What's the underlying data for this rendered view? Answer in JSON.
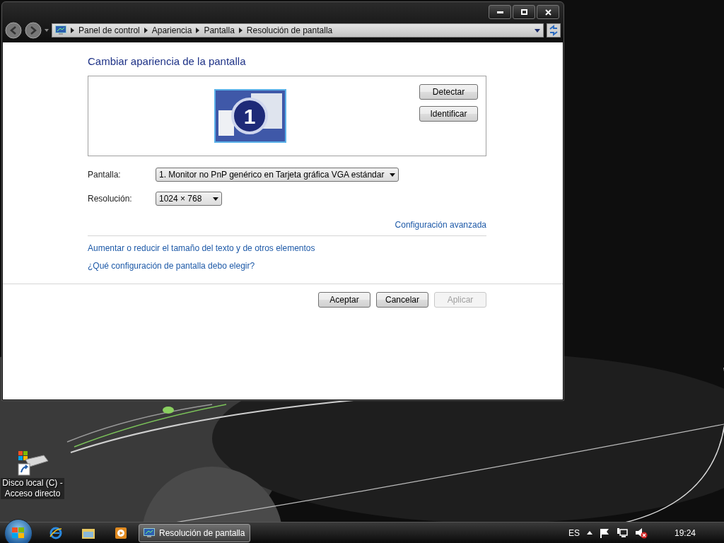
{
  "window": {
    "breadcrumb": [
      "Panel de control",
      "Apariencia",
      "Pantalla",
      "Resolución de pantalla"
    ],
    "heading": "Cambiar apariencia de la pantalla",
    "monitor_number": "1",
    "preview_buttons": [
      {
        "label": "Detectar"
      },
      {
        "label": "Identificar"
      }
    ],
    "fields": [
      {
        "label": "Pantalla:",
        "value": "1. Monitor no PnP genérico en Tarjeta gráfica VGA estándar"
      },
      {
        "label": "Resolución:",
        "value": "1024 × 768"
      }
    ],
    "advanced_link": "Configuración avanzada",
    "links": [
      "Aumentar o reducir el tamaño del texto y de otros elementos",
      "¿Qué configuración de pantalla debo elegir?"
    ],
    "dialog_buttons": [
      {
        "label": "Aceptar",
        "disabled": false
      },
      {
        "label": "Cancelar",
        "disabled": false
      },
      {
        "label": "Aplicar",
        "disabled": true
      }
    ]
  },
  "desktop_icons": [
    {
      "label": "Disco local (C) - Acceso directo"
    }
  ],
  "taskbar": {
    "tasks": [
      {
        "label": "Resolución de pantalla",
        "selected": true
      }
    ],
    "language": "ES",
    "clock": "19:24",
    "volume_muted": true
  }
}
